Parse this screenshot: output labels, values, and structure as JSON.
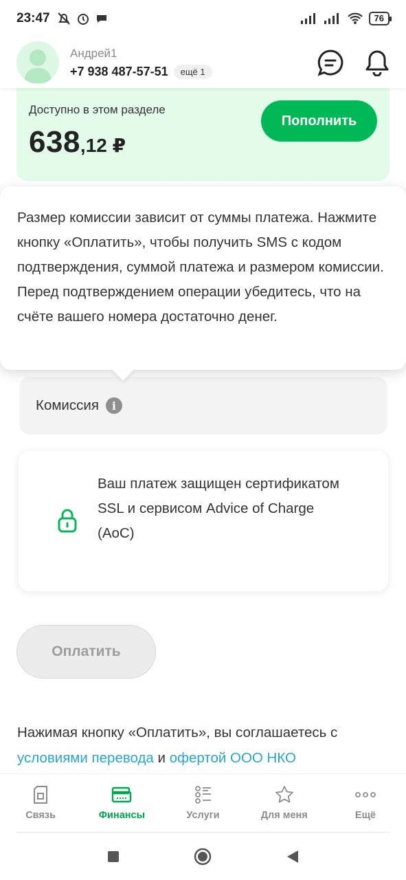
{
  "status_bar": {
    "time": "23:47",
    "battery": "76"
  },
  "header": {
    "user_name": "Андрей1",
    "phone": "+7 938 487-57-51",
    "more_chip": "ещё 1"
  },
  "balance": {
    "label": "Доступно в этом разделе",
    "amount_main": "638",
    "amount_fraction": ",12 ₽",
    "topup_label": "Пополнить"
  },
  "tooltip": {
    "text": "Размер комиссии зависит от суммы платежа. Нажмите кнопку «Оплатить», чтобы получить SMS с кодом подтверждения, суммой платежа и размером комиссии. Перед подтверждением операции убедитесь, что на счёте вашего номера достаточно денег."
  },
  "commission": {
    "label": "Комиссия",
    "info_glyph": "i"
  },
  "security": {
    "text": "Ваш платеж защищен сертификатом SSL и сервисом Advice of Charge (AoC)"
  },
  "pay_button": {
    "label": "Оплатить"
  },
  "agreement": {
    "prefix": "Нажимая кнопку «Оплатить», вы соглашаетесь с",
    "link1": "условиями перевода",
    "conj": "и",
    "link2": "офертой ООО НКО"
  },
  "bottom_nav": {
    "items": [
      {
        "label": "Связь",
        "icon": "sim-card-icon",
        "active": false
      },
      {
        "label": "Финансы",
        "icon": "wallet-icon",
        "active": true
      },
      {
        "label": "Услуги",
        "icon": "services-list-icon",
        "active": false
      },
      {
        "label": "Для меня",
        "icon": "star-icon",
        "active": false
      },
      {
        "label": "Ещё",
        "icon": "more-dots-icon",
        "active": false
      }
    ]
  },
  "colors": {
    "brand_green": "#00b956",
    "balance_bg": "#e3fbe9",
    "link": "#2aa6c8"
  }
}
